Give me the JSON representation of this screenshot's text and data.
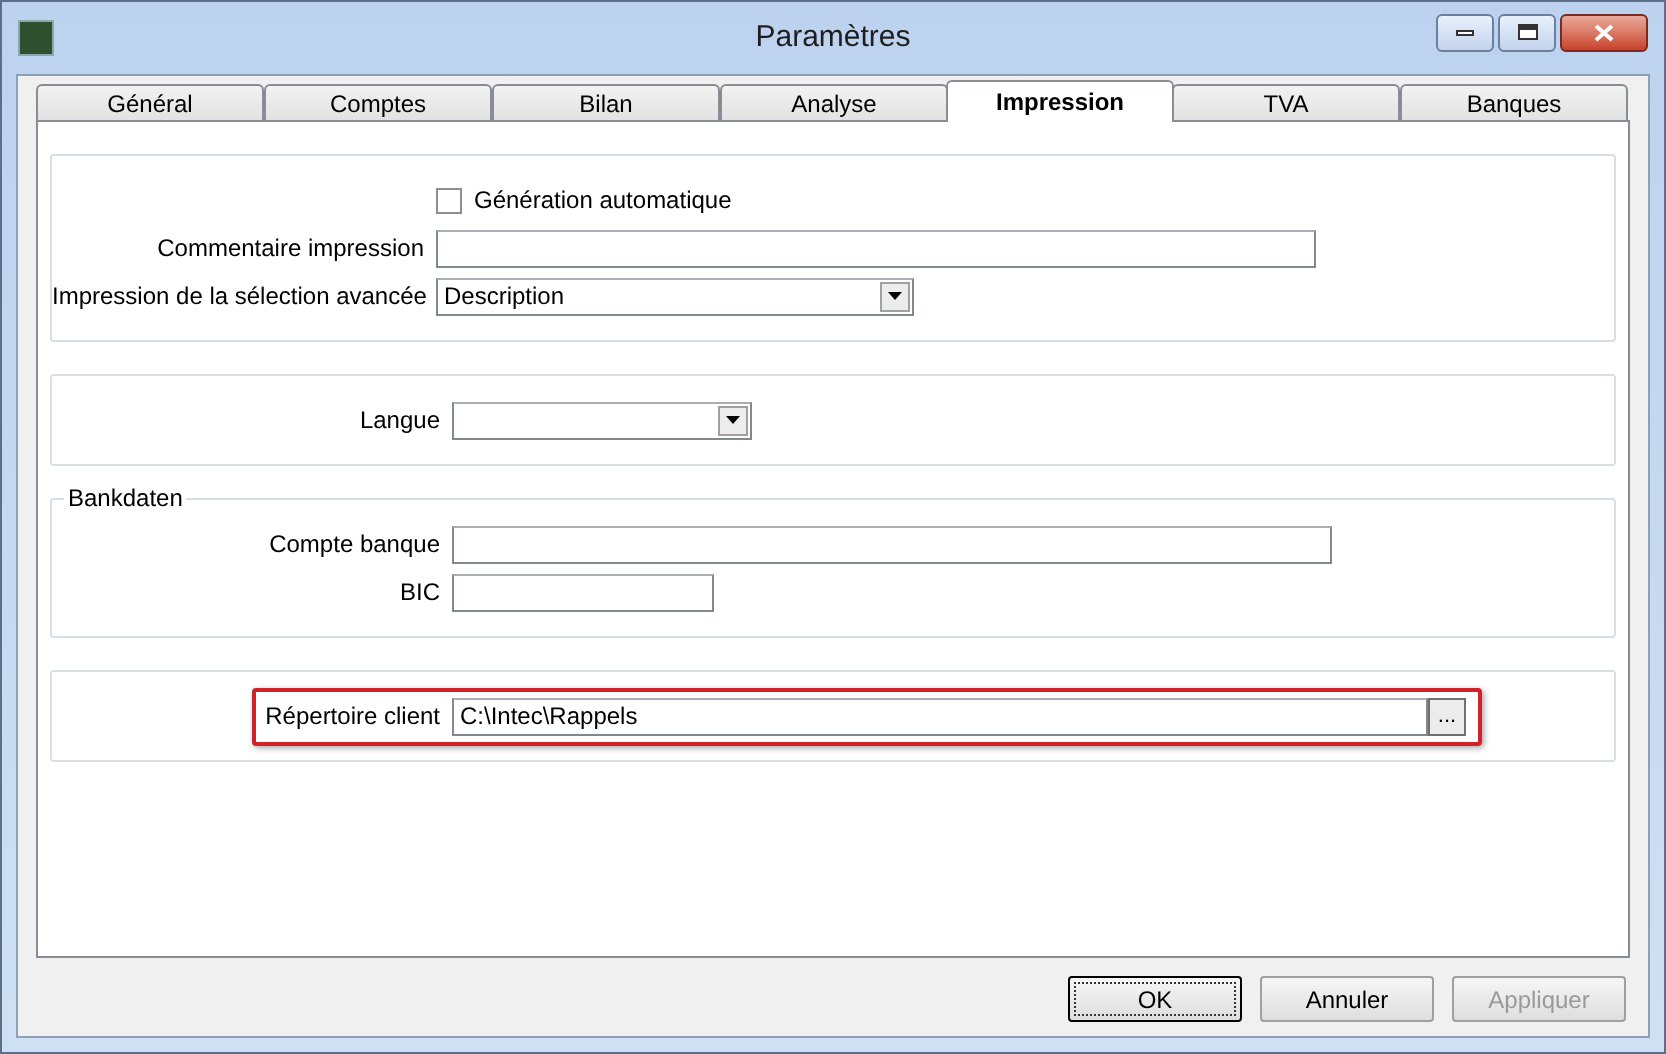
{
  "window": {
    "title": "Paramètres"
  },
  "tabs": [
    {
      "label": "Général",
      "selected": false
    },
    {
      "label": "Comptes",
      "selected": false
    },
    {
      "label": "Bilan",
      "selected": false
    },
    {
      "label": "Analyse",
      "selected": false
    },
    {
      "label": "Impression",
      "selected": true
    },
    {
      "label": "TVA",
      "selected": false
    },
    {
      "label": "Banques",
      "selected": false
    }
  ],
  "groups": [
    {
      "fields": [
        {
          "kind": "checkbox",
          "label": "Génération automatique",
          "checked": false
        },
        {
          "kind": "text",
          "label": "Commentaire impression"
        },
        {
          "kind": "select",
          "label": "Impression de la sélection avancée",
          "value": "Description"
        }
      ]
    },
    {
      "fields": [
        {
          "kind": "select",
          "label": "Langue"
        }
      ]
    },
    {
      "title": "Bankdaten",
      "fields": [
        {
          "kind": "text",
          "label": "Compte banque"
        },
        {
          "kind": "text",
          "label": "BIC"
        }
      ]
    },
    {
      "fields": [
        {
          "kind": "browse",
          "label": "Répertoire client",
          "value": "C:\\Intec\\Rappels",
          "button": "...",
          "highlighted": true
        }
      ]
    }
  ],
  "buttons": [
    {
      "label": "OK",
      "default": true,
      "disabled": false
    },
    {
      "label": "Annuler",
      "default": false,
      "disabled": false
    },
    {
      "label": "Appliquer",
      "default": false,
      "disabled": true
    }
  ]
}
